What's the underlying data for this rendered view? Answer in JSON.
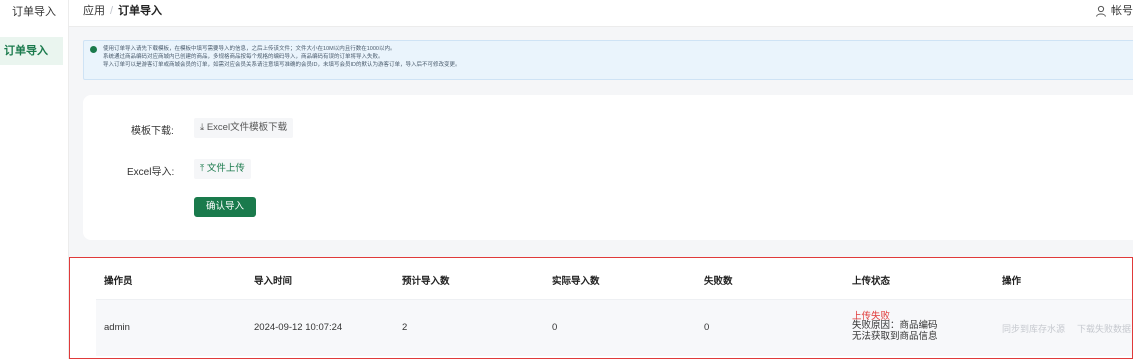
{
  "sidebar": {
    "title": "订单导入",
    "active_item": "订单导入"
  },
  "breadcrumb": {
    "parent": "应用",
    "separator": "/",
    "current": "订单导入"
  },
  "account": {
    "label": "帐号"
  },
  "notice": {
    "lines": [
      "使用订单导入请先下载模板，在模板中填写需要导入的信息，之后上传该文件；文件大小在10M以内且行数在1000以内。",
      "系统通过商品编码对应商城内已创建的商品，多规格商品按每个规格的编码导入，商品编码有误的订单将导入失败。",
      "导入订单可以是游客订单或商城会员的订单，如需对应会员关系请注意填写准确的会员ID，未填写会员ID的默认为游客订单，导入后不可修改变更。"
    ]
  },
  "form": {
    "template_label": "模板下载:",
    "template_button": "Excel文件模板下载",
    "import_label": "Excel导入:",
    "upload_button": "文件上传",
    "confirm_button": "确认导入"
  },
  "table": {
    "headers": [
      "操作员",
      "导入时间",
      "预计导入数",
      "实际导入数",
      "失败数",
      "上传状态",
      "操作"
    ],
    "rows": [
      {
        "operator": "admin",
        "time": "2024-09-12 10:07:24",
        "expected": "2",
        "actual": "0",
        "failed": "0",
        "status": "上传失败",
        "reason": "失败原因：商品编码无法获取到商品信息",
        "op_sync": "同步到库存水源",
        "op_download": "下载失败数据"
      }
    ]
  },
  "colors": {
    "primary": "#1a7a4c",
    "danger": "#e03a3a",
    "info_bg": "#eaf4fc"
  }
}
